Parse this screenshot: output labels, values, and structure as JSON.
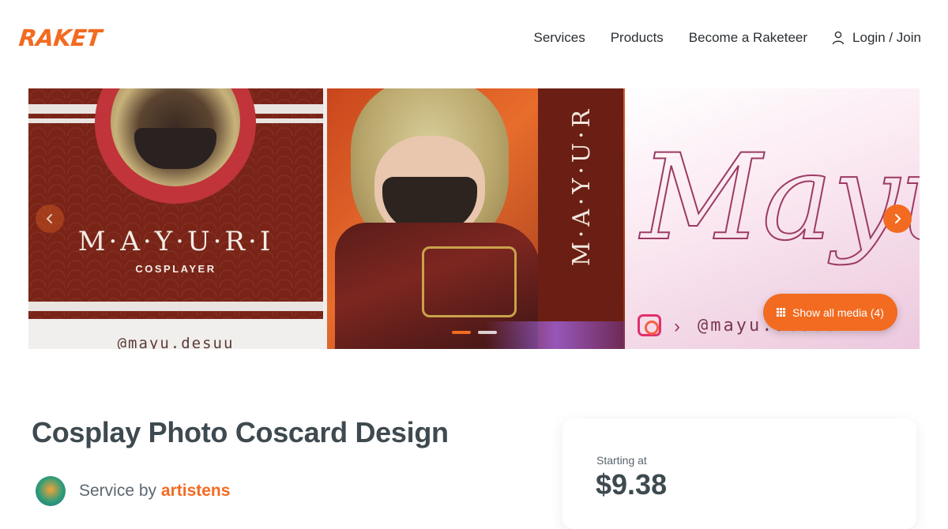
{
  "header": {
    "logo": "RAKET",
    "nav": {
      "services": "Services",
      "products": "Products",
      "become": "Become a Raketeer",
      "login": "Login / Join"
    }
  },
  "gallery": {
    "slide1": {
      "name": "M·A·Y·U·R·I",
      "role": "COSPLAYER",
      "handle": "@mayu.desuu"
    },
    "slide2": {
      "vertical_name": "M·A·Y·U·R"
    },
    "slide3": {
      "script_text": "Mayuri",
      "handle": "@mayu.desuu"
    },
    "show_all_label": "Show all media (4)",
    "dots": 2,
    "active_dot": 0,
    "accent_color": "#f26b21"
  },
  "service": {
    "title": "Cosplay Photo Coscard Design",
    "service_by_label": "Service by",
    "seller_name": "artistens"
  },
  "pricing": {
    "starting_label": "Starting at",
    "price": "$9.38"
  }
}
